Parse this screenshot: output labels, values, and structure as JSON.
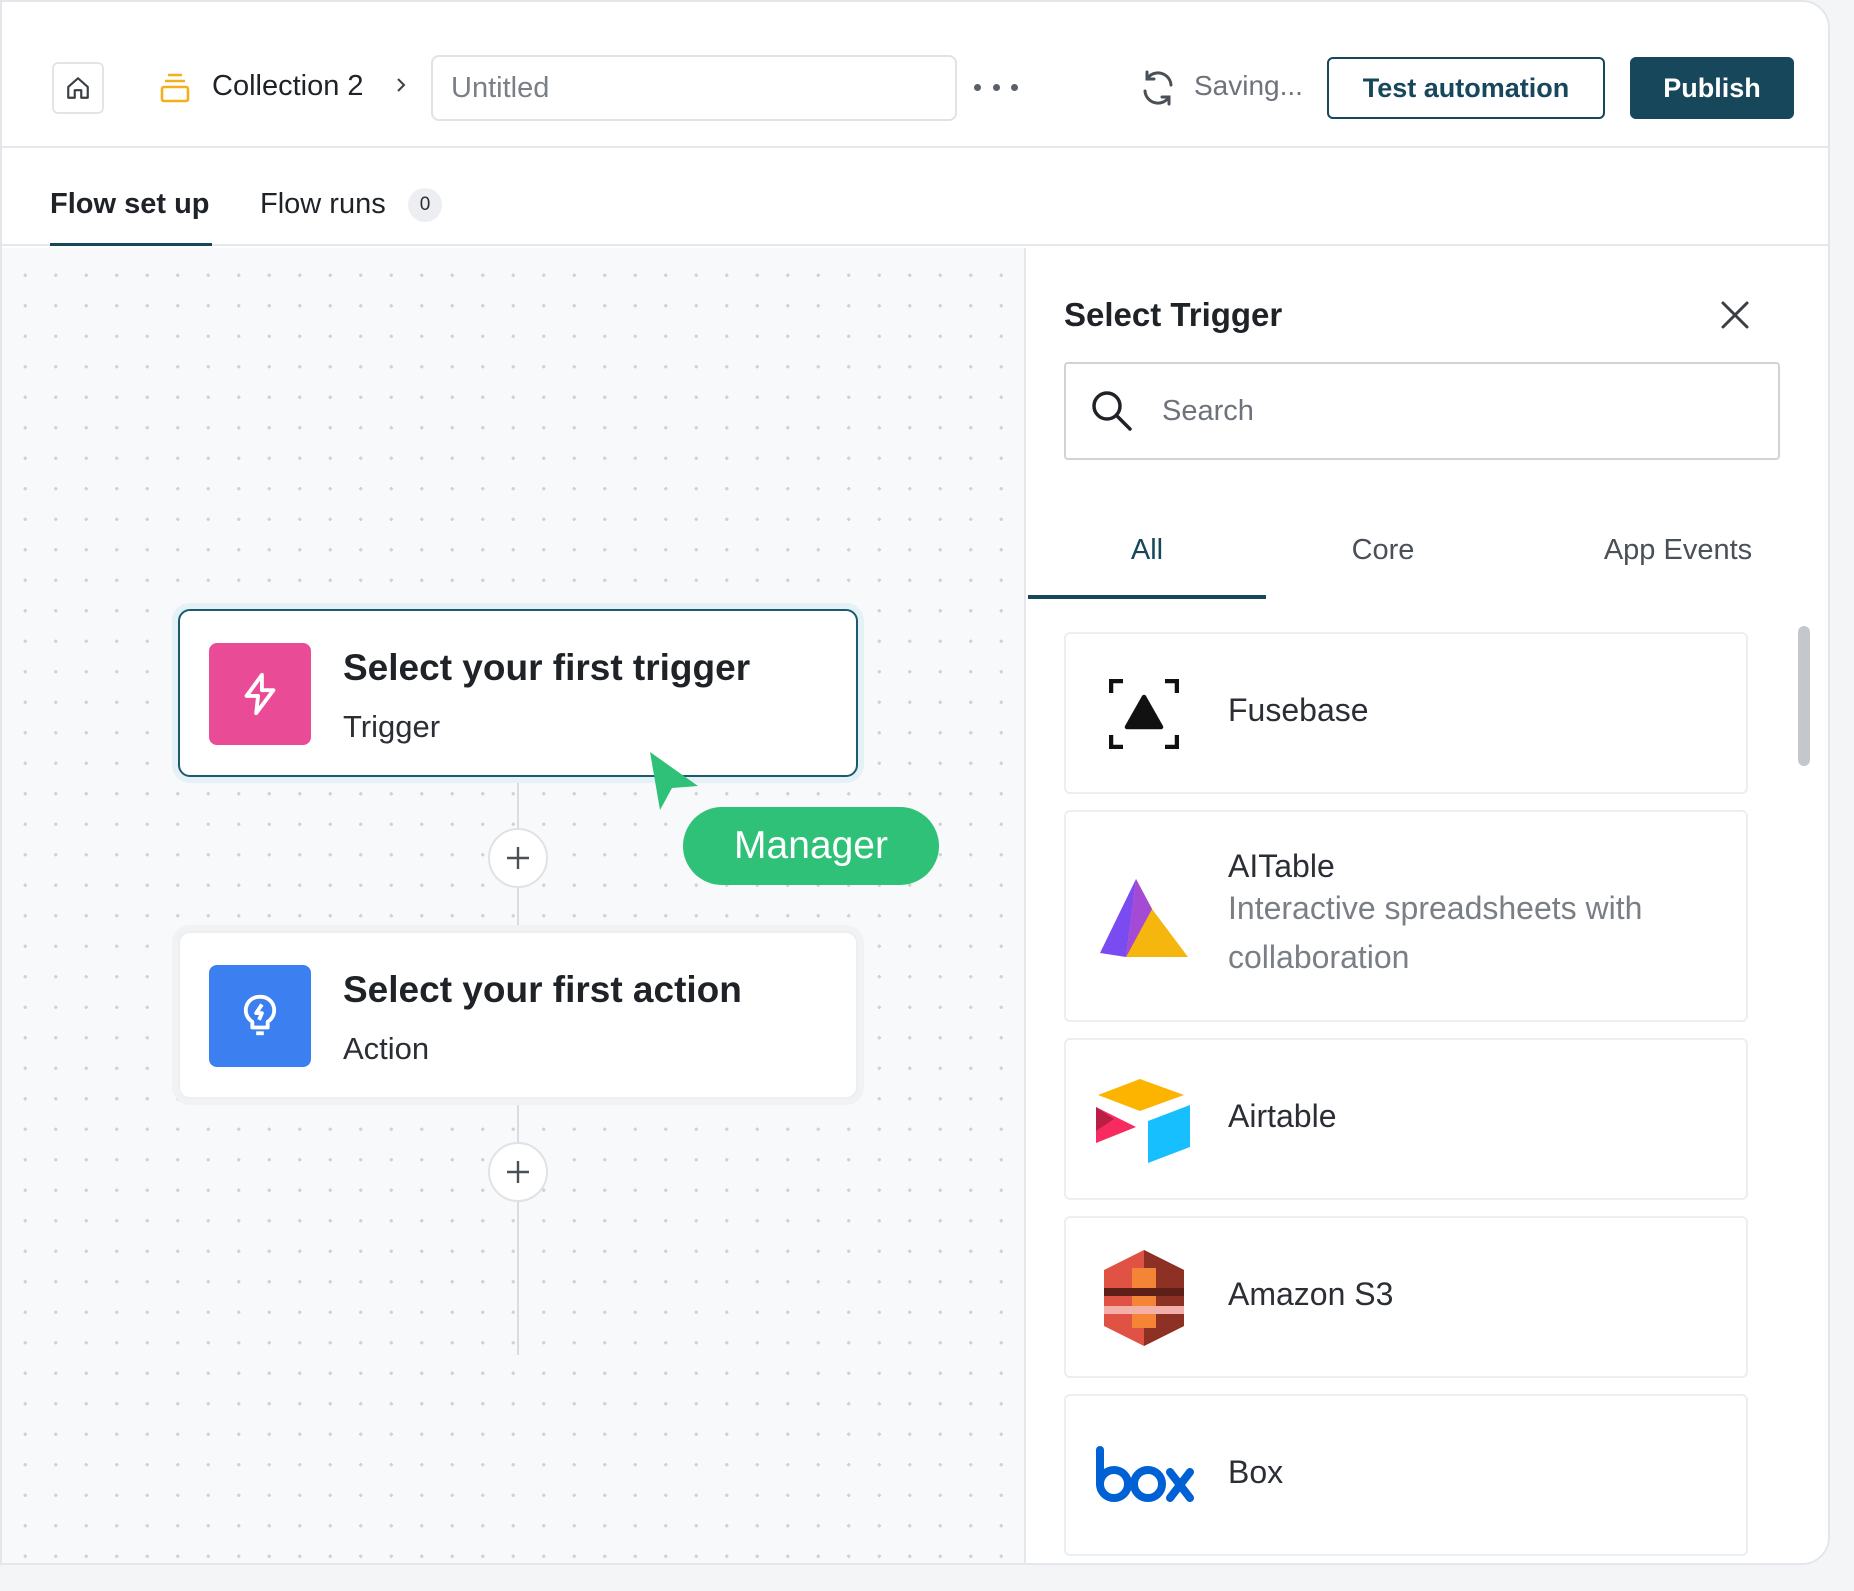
{
  "header": {
    "breadcrumb_collection": "Collection 2",
    "title_placeholder": "Untitled",
    "saving_text": "Saving...",
    "test_button": "Test automation",
    "publish_button": "Publish"
  },
  "tabs": {
    "setup": "Flow set up",
    "runs": "Flow runs",
    "runs_count": "0"
  },
  "canvas": {
    "trigger": {
      "title": "Select your first trigger",
      "subtitle": "Trigger",
      "icon": "lightning-icon",
      "color": "#ea4b96"
    },
    "action": {
      "title": "Select your first action",
      "subtitle": "Action",
      "icon": "bulb-icon",
      "color": "#3b7ff0"
    },
    "cursor_label": "Manager",
    "cursor_color": "#2fc178"
  },
  "panel": {
    "title": "Select Trigger",
    "search_placeholder": "Search",
    "tabs": [
      "All",
      "Core",
      "App Events"
    ],
    "active_tab": "All",
    "apps": [
      {
        "name": "Fusebase",
        "desc": ""
      },
      {
        "name": "AITable",
        "desc": "Interactive spreadsheets with collaboration"
      },
      {
        "name": "Airtable",
        "desc": ""
      },
      {
        "name": "Amazon S3",
        "desc": ""
      },
      {
        "name": "Box",
        "desc": ""
      }
    ]
  },
  "colors": {
    "primary": "#17475a",
    "accent_green": "#2fc178"
  }
}
